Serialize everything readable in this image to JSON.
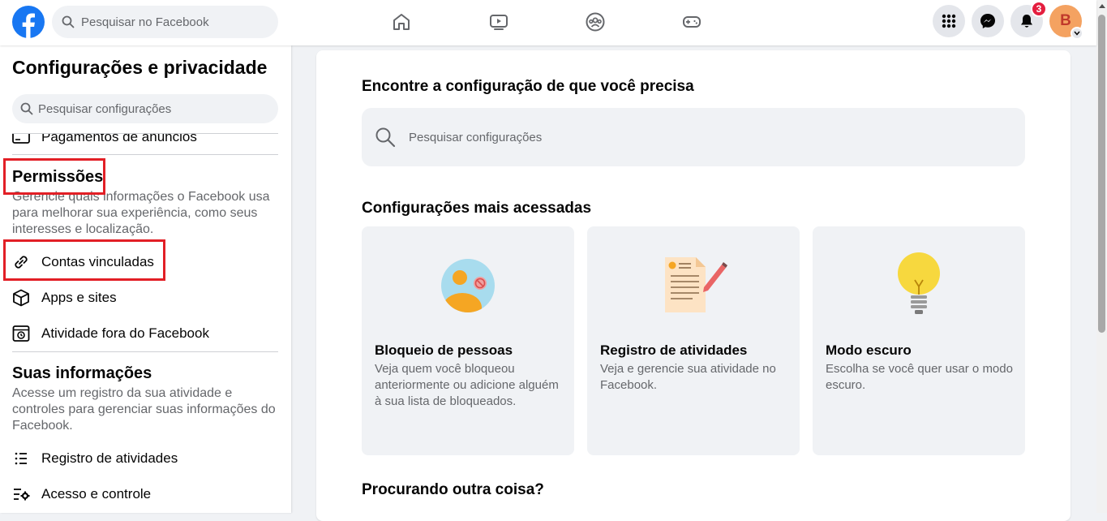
{
  "topbar": {
    "search_placeholder": "Pesquisar no Facebook",
    "notification_count": "3",
    "avatar_initial": "B",
    "nav_icons": [
      "home-icon",
      "watch-icon",
      "groups-icon",
      "gaming-icon"
    ],
    "right_icons": [
      "menu-grid-icon",
      "messenger-icon",
      "bell-icon"
    ]
  },
  "sidebar": {
    "title": "Configurações e privacidade",
    "search_placeholder": "Pesquisar configurações",
    "partial_item": "Pagamentos de anúncios",
    "permissions": {
      "title": "Permissões",
      "description": "Gerencie quais informações o Facebook usa para melhorar sua experiência, como seus interesses e localização.",
      "items": [
        {
          "label": "Contas vinculadas",
          "icon": "link-icon"
        },
        {
          "label": "Apps e sites",
          "icon": "cube-icon"
        },
        {
          "label": "Atividade fora do Facebook",
          "icon": "history-icon"
        }
      ]
    },
    "your_info": {
      "title": "Suas informações",
      "description": "Acesse um registro da sua atividade e controles para gerenciar suas informações do Facebook.",
      "items": [
        {
          "label": "Registro de atividades",
          "icon": "list-icon"
        },
        {
          "label": "Acesso e controle",
          "icon": "list-gear-icon"
        }
      ]
    }
  },
  "main": {
    "heading": "Encontre a configuração de que você precisa",
    "search_placeholder": "Pesquisar configurações",
    "most_accessed_heading": "Configurações mais acessadas",
    "cards": [
      {
        "title": "Bloqueio de pessoas",
        "description": "Veja quem você bloqueou anteriormente ou adicione alguém à sua lista de bloqueados.",
        "icon": "blocked-person-icon"
      },
      {
        "title": "Registro de atividades",
        "description": "Veja e gerencie sua atividade no Facebook.",
        "icon": "activity-log-icon"
      },
      {
        "title": "Modo escuro",
        "description": "Escolha se você quer usar o modo escuro.",
        "icon": "lightbulb-icon"
      }
    ],
    "other_heading": "Procurando outra coisa?"
  },
  "colors": {
    "facebook_blue": "#1877f2",
    "highlight_red": "#e21f26",
    "badge_red": "#e41e3f"
  }
}
